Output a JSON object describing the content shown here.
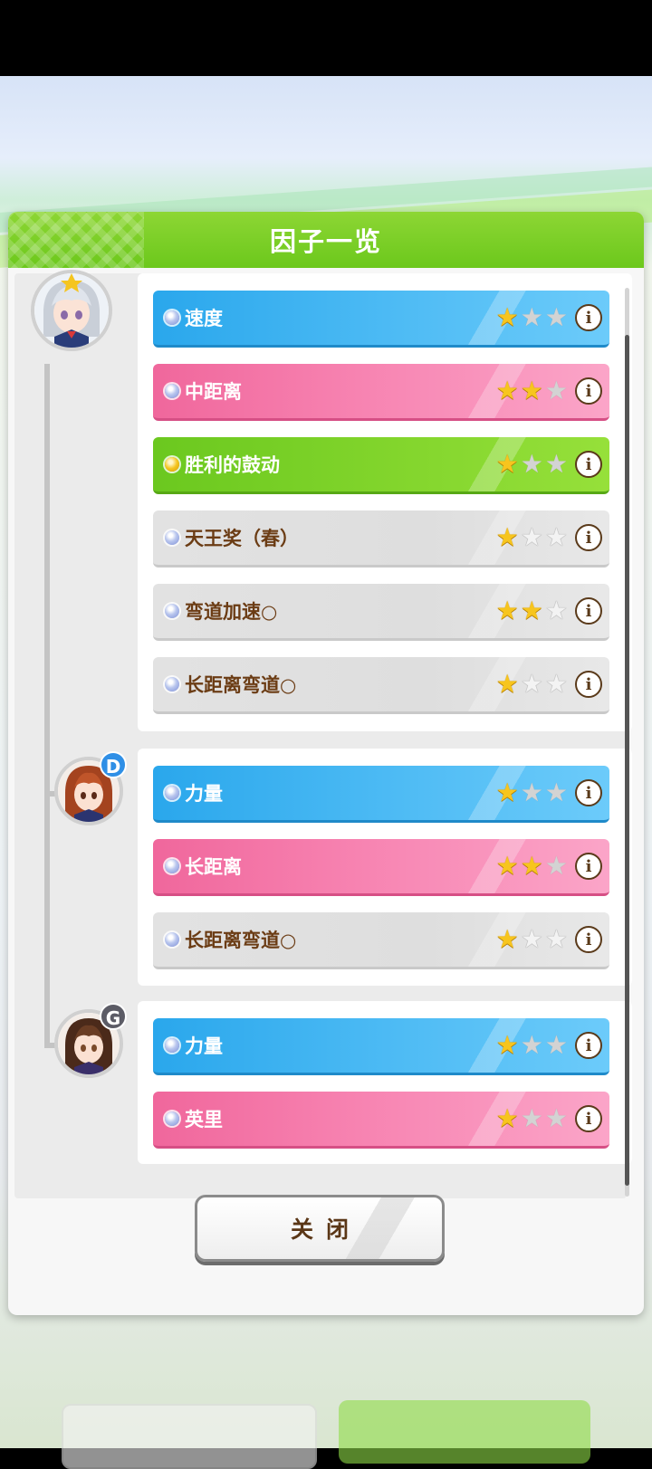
{
  "modal": {
    "title": "因子一览",
    "close_label": "关闭"
  },
  "groups": [
    {
      "avatar": "white-haired-horse-girl-avatar",
      "badge": "",
      "factors": [
        {
          "name": "速度",
          "color": "blue",
          "stars": 1,
          "dot": "blue"
        },
        {
          "name": "中距离",
          "color": "pink",
          "stars": 2,
          "dot": "blue"
        },
        {
          "name": "胜利的鼓动",
          "color": "green",
          "stars": 1,
          "dot": "gold"
        },
        {
          "name": "天王奖（春）",
          "color": "gray",
          "stars": 1,
          "dot": "blue"
        },
        {
          "name": "弯道加速○",
          "color": "gray",
          "stars": 2,
          "dot": "blue"
        },
        {
          "name": "长距离弯道○",
          "color": "gray",
          "stars": 1,
          "dot": "blue"
        }
      ]
    },
    {
      "avatar": "brown-haired-horse-girl-avatar",
      "badge": "D",
      "factors": [
        {
          "name": "力量",
          "color": "blue",
          "stars": 1,
          "dot": "blue"
        },
        {
          "name": "长距离",
          "color": "pink",
          "stars": 2,
          "dot": "blue"
        },
        {
          "name": "长距离弯道○",
          "color": "gray",
          "stars": 1,
          "dot": "blue"
        }
      ]
    },
    {
      "avatar": "dark-haired-horse-girl-avatar",
      "badge": "G",
      "factors": [
        {
          "name": "力量",
          "color": "blue",
          "stars": 1,
          "dot": "blue"
        },
        {
          "name": "英里",
          "color": "pink",
          "stars": 1,
          "dot": "blue"
        }
      ]
    }
  ],
  "colors": {
    "header_green": "#7ccf28",
    "blue_factor": "#48b8f3",
    "pink_factor": "#f783b1",
    "green_factor": "#7fd32a",
    "gray_factor": "#dedede",
    "star_gold": "#f7c51e",
    "brown_text": "#5a3616"
  },
  "icons": {
    "info": "i",
    "star": "★"
  }
}
